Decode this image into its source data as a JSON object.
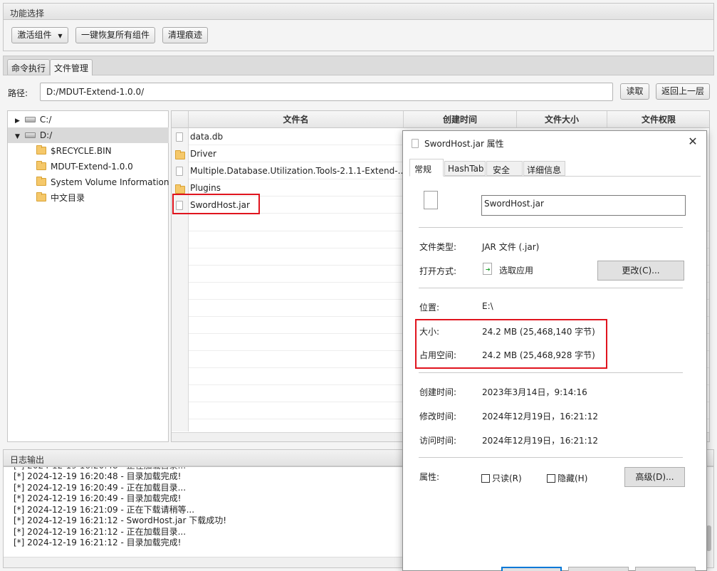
{
  "app": {
    "function_panel_title": "功能选择",
    "activate_label": "激活组件",
    "restore_label": "一键恢复所有组件",
    "clean_label": "清理痕迹"
  },
  "tabs": [
    {
      "label": "命令执行"
    },
    {
      "label": "文件管理"
    }
  ],
  "path": {
    "label": "路径:",
    "value": "D:/MDUT-Extend-1.0.0/",
    "read_label": "读取",
    "back_label": "返回上一层"
  },
  "tree": {
    "items": [
      {
        "label": "C:/"
      },
      {
        "label": "D:/"
      },
      {
        "label": "$RECYCLE.BIN"
      },
      {
        "label": "MDUT-Extend-1.0.0"
      },
      {
        "label": "System Volume Information"
      },
      {
        "label": "中文目录"
      }
    ]
  },
  "table": {
    "columns": [
      "文件名",
      "创建时间",
      "文件大小",
      "文件权限"
    ],
    "rows": [
      {
        "name": "data.db"
      },
      {
        "name": "Driver"
      },
      {
        "name": "Multiple.Database.Utilization.Tools-2.1.1-Extend-..."
      },
      {
        "name": "Plugins"
      },
      {
        "name": "SwordHost.jar"
      }
    ]
  },
  "log": {
    "title": "日志输出",
    "lines": [
      "[*] 2024-12-19 16:20:48 - 目录加载完成!",
      "[*] 2024-12-19 16:20:49 - 正在加载目录...",
      "[*] 2024-12-19 16:20:49 - 目录加载完成!",
      "[*] 2024-12-19 16:21:09 - 正在下载请稍等...",
      "[*] 2024-12-19 16:21:12 - SwordHost.jar 下载成功!",
      "[*] 2024-12-19 16:21:12 - 正在加载目录...",
      "[*] 2024-12-19 16:21:12 - 目录加载完成!"
    ]
  },
  "dialog": {
    "title": "SwordHost.jar 属性",
    "tabs": [
      "常规",
      "HashTab",
      "安全",
      "详细信息"
    ],
    "filename": "SwordHost.jar",
    "type_label": "文件类型:",
    "type_value": "JAR 文件 (.jar)",
    "open_label": "打开方式:",
    "open_value": "选取应用",
    "change_label": "更改(C)...",
    "location_label": "位置:",
    "location_value": "E:\\",
    "size_label": "大小:",
    "size_value": "24.2 MB (25,468,140 字节)",
    "disk_label": "占用空间:",
    "disk_value": "24.2 MB (25,468,928 字节)",
    "created_label": "创建时间:",
    "created_value": "2023年3月14日，9:14:16",
    "modified_label": "修改时间:",
    "modified_value": "2024年12月19日，16:21:12",
    "accessed_label": "访问时间:",
    "accessed_value": "2024年12月19日，16:21:12",
    "attr_label": "属性:",
    "readonly_label": "只读(R)",
    "hidden_label": "隐藏(H)",
    "advanced_label": "高级(D)..."
  },
  "colors": {
    "highlight": "#e0141e",
    "selection": "#d9d9d9",
    "accent": "#0078d7"
  }
}
